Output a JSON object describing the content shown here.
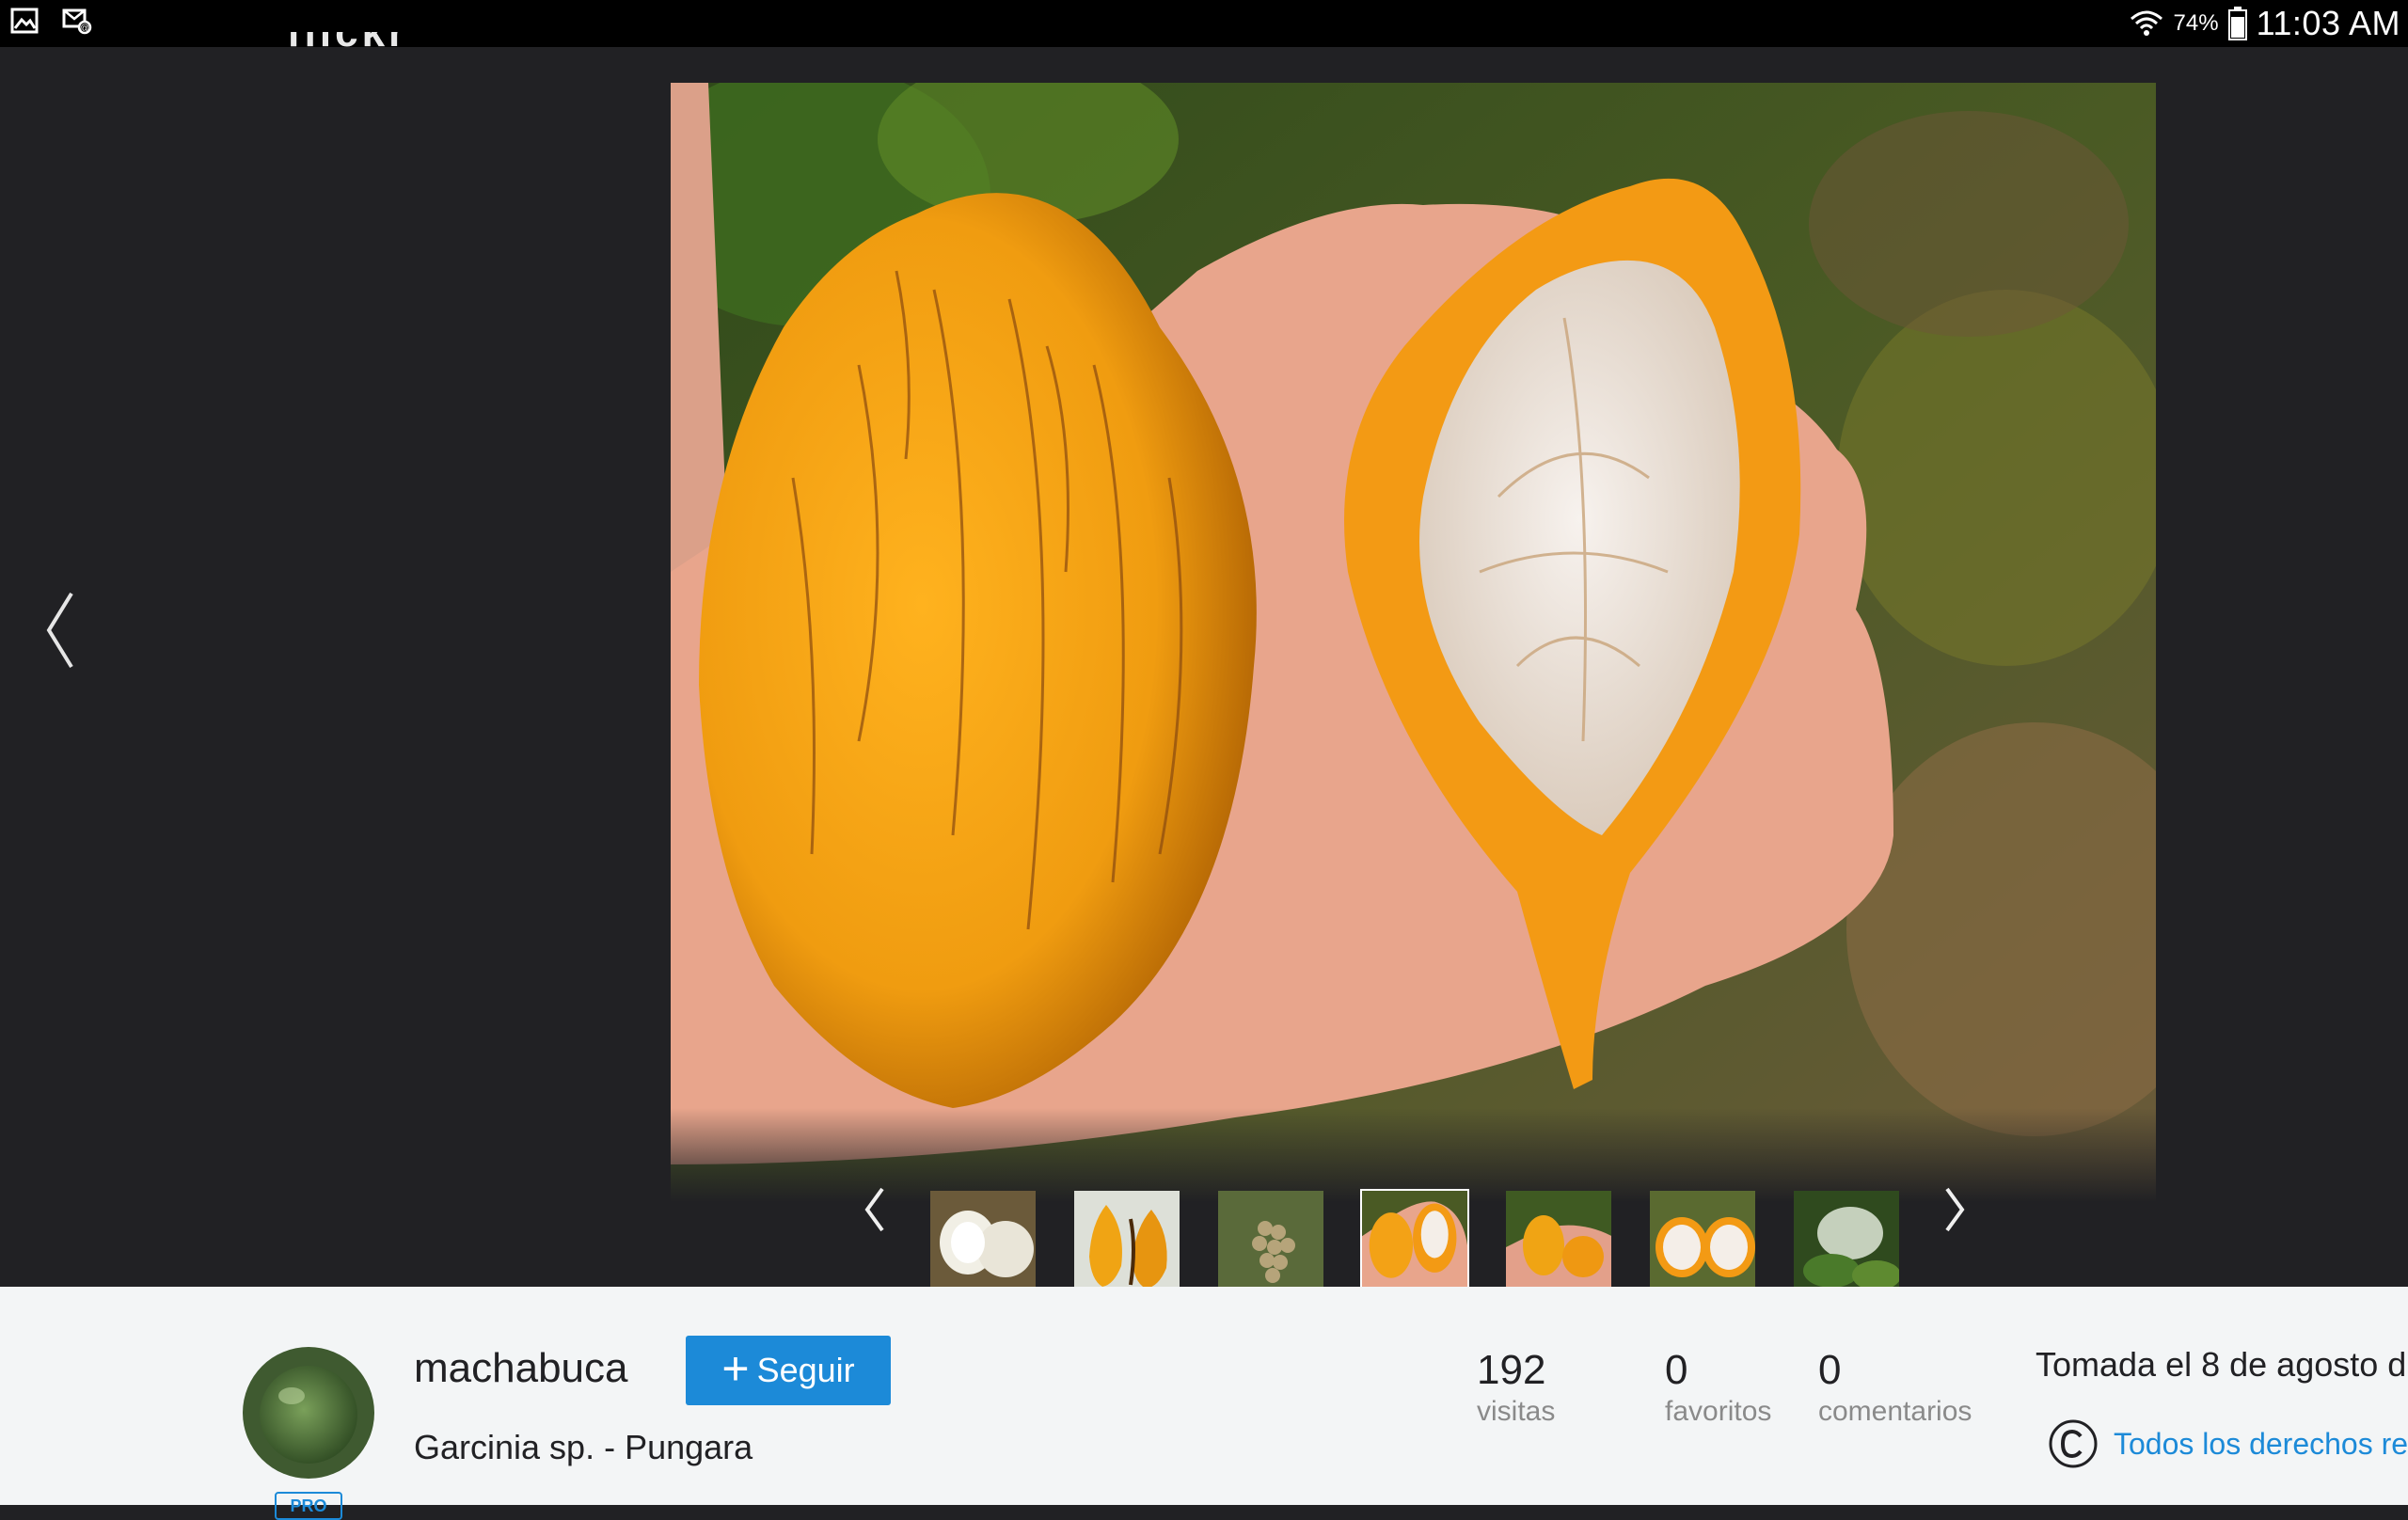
{
  "status_bar": {
    "battery_pct": "74%",
    "time": "11:03 AM",
    "icons": [
      "gallery-icon",
      "email-icon",
      "wifi-icon",
      "battery-icon"
    ]
  },
  "header": {
    "logo": "flickr"
  },
  "viewer": {
    "prev_icon": "chevron-left-icon",
    "filmstrip_prev_icon": "chevron-left-icon",
    "filmstrip_next_icon": "chevron-right-icon",
    "thumbnails": [
      {
        "label": "thumbnail 1",
        "active": false
      },
      {
        "label": "thumbnail 2",
        "active": false
      },
      {
        "label": "thumbnail 3",
        "active": false
      },
      {
        "label": "thumbnail 4",
        "active": true
      },
      {
        "label": "thumbnail 5",
        "active": false
      },
      {
        "label": "thumbnail 6",
        "active": false
      },
      {
        "label": "thumbnail 7",
        "active": false
      }
    ]
  },
  "info": {
    "username": "machabuca",
    "pro_badge": "PRO",
    "follow_label": "Seguir",
    "title": "Garcinia sp. - Pungara",
    "stats": [
      {
        "value": "192",
        "label": "visitas"
      },
      {
        "value": "0",
        "label": "favoritos"
      },
      {
        "value": "0",
        "label": "comentarios"
      }
    ],
    "taken_on": "Tomada el 8 de agosto d",
    "license": "Todos los derechos re"
  },
  "colors": {
    "accent": "#1c8ad8",
    "viewer_bg": "#212124",
    "panel_bg": "#f3f5f6"
  }
}
